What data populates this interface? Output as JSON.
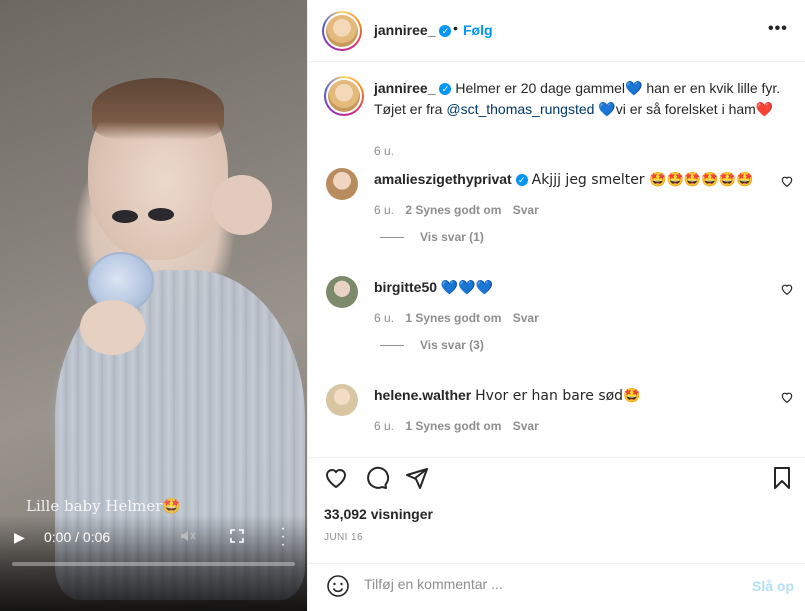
{
  "video": {
    "overlay_caption": "Lille baby Helmer🤩",
    "time": "0:00 / 0:06",
    "progress": 0
  },
  "header": {
    "username": "janniree_",
    "dot": "•",
    "follow_label": "Følg",
    "more": "•••"
  },
  "caption": {
    "username": "janniree_",
    "text_a": "Helmer er 20 dage gammel",
    "heart1": "💙",
    "text_b": "han er en kvik lille fyr. Tøjet er fra",
    "mention": "@sct_thomas_rungsted",
    "heart2": "💙",
    "text_c": "vi er så forelsket i ham",
    "heart3": "❤️",
    "age": "6 u."
  },
  "comments": [
    {
      "username": "amalieszigethyprivat",
      "verified": true,
      "text": "Akjjj jeg smelter 🤩🤩🤩🤩🤩🤩",
      "age": "6 u.",
      "likes": "2 Synes godt om",
      "reply": "Svar",
      "view_replies": "Vis svar (1)"
    },
    {
      "username": "birgitte50",
      "verified": false,
      "text": "💙💙💙",
      "age": "6 u.",
      "likes": "1 Synes godt om",
      "reply": "Svar",
      "view_replies": "Vis svar (3)"
    },
    {
      "username": "helene.walther",
      "verified": false,
      "text": "Hvor er han bare sød🤩",
      "age": "6 u.",
      "likes": "1 Synes godt om",
      "reply": "Svar"
    }
  ],
  "actions": {
    "views": "33,092 visninger",
    "date": "JUNI 16"
  },
  "add_comment": {
    "placeholder": "Tilføj en kommentar ...",
    "post_label": "Slå op"
  },
  "colors": {
    "accent": "#0095f6",
    "text": "#262626",
    "muted": "#8e8e8e",
    "border": "#efefef"
  }
}
